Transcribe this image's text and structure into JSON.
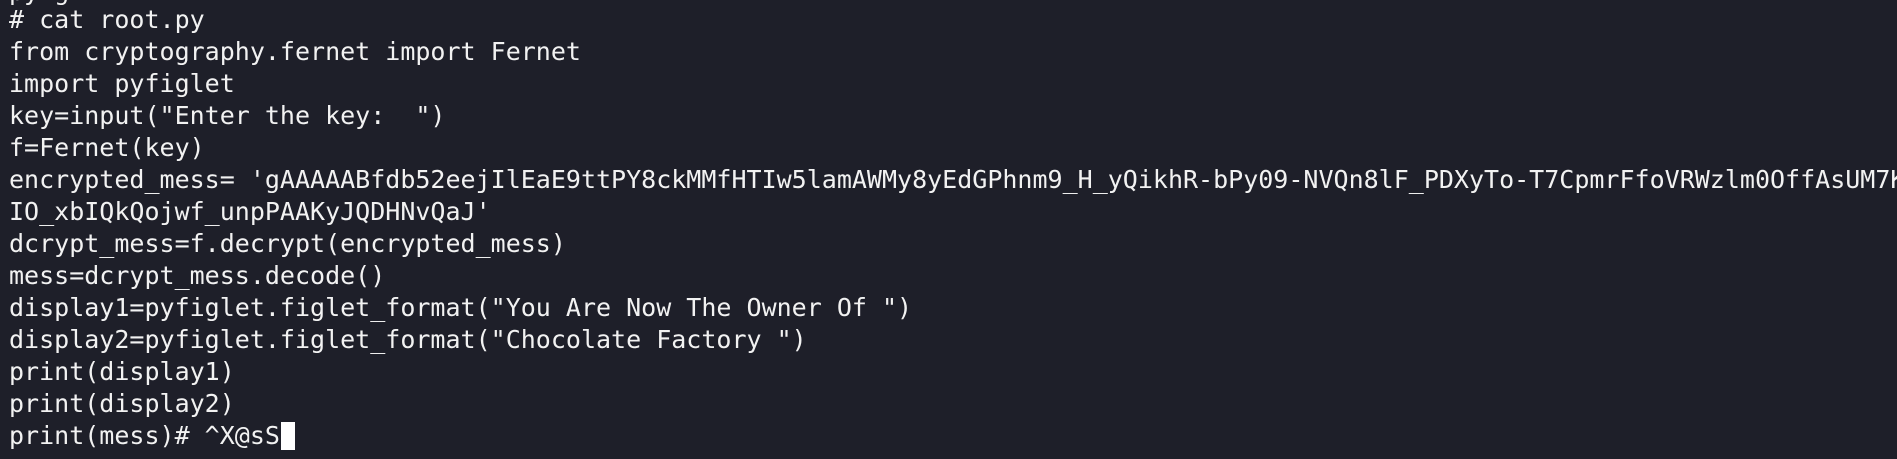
{
  "terminal": {
    "top_partial": "py g",
    "lines": [
      "# cat root.py",
      "from cryptography.fernet import Fernet",
      "import pyfiglet",
      "key=input(\"Enter the key:  \")",
      "f=Fernet(key)",
      "encrypted_mess= 'gAAAAABfdb52eejIlEaE9ttPY8ckMMfHTIw5lamAWMy8yEdGPhnm9_H_yQikhR-bPy09-NVQn8lF_PDXyTo-T7CpmrFfoVRWzlm0OffAsUM7K",
      "IO_xbIQkQojwf_unpPAAKyJQDHNvQaJ'",
      "dcrypt_mess=f.decrypt(encrypted_mess)",
      "mess=dcrypt_mess.decode()",
      "display1=pyfiglet.figlet_format(\"You Are Now The Owner Of \")",
      "display2=pyfiglet.figlet_format(\"Chocolate Factory \")",
      "print(display1)",
      "print(display2)",
      "print(mess)# ^X@sS"
    ]
  },
  "colors": {
    "background": "#1e1f29",
    "text": "#f2f2f2",
    "cursor": "#ffffff"
  }
}
